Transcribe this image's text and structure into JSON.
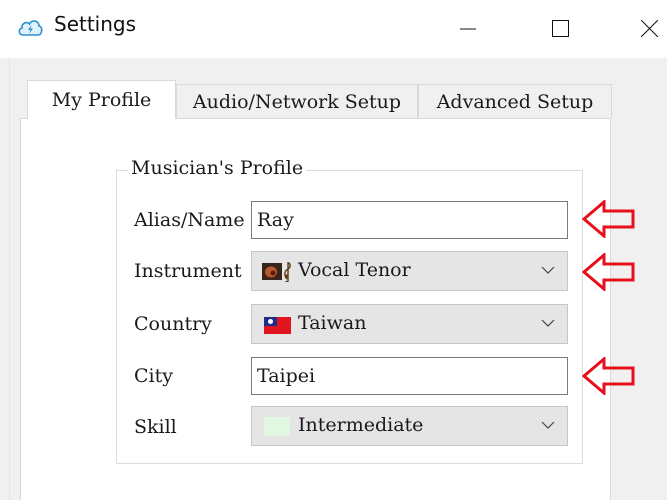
{
  "window": {
    "title": "Settings",
    "app_icon": "sync-cloud-icon",
    "controls": [
      "minimize-icon",
      "maximize-icon",
      "close-icon"
    ]
  },
  "tabs": [
    {
      "label": "My Profile",
      "active": true
    },
    {
      "label": "Audio/Network Setup",
      "active": false
    },
    {
      "label": "Advanced Setup",
      "active": false
    }
  ],
  "profile": {
    "group_title": "Musician's Profile",
    "fields": {
      "alias": {
        "label": "Alias/Name",
        "value": "Ray"
      },
      "instrument": {
        "label": "Instrument",
        "value": "Vocal Tenor",
        "icon": "vocal-tenor-icon"
      },
      "country": {
        "label": "Country",
        "value": "Taiwan",
        "icon": "taiwan-flag-icon"
      },
      "city": {
        "label": "City",
        "value": "Taipei"
      },
      "skill": {
        "label": "Skill",
        "value": "Intermediate",
        "swatch_color": "#e2f7e2"
      }
    }
  },
  "annotations": {
    "arrow_color": "#e8101b",
    "pointing_to": [
      "alias",
      "instrument",
      "city"
    ]
  }
}
